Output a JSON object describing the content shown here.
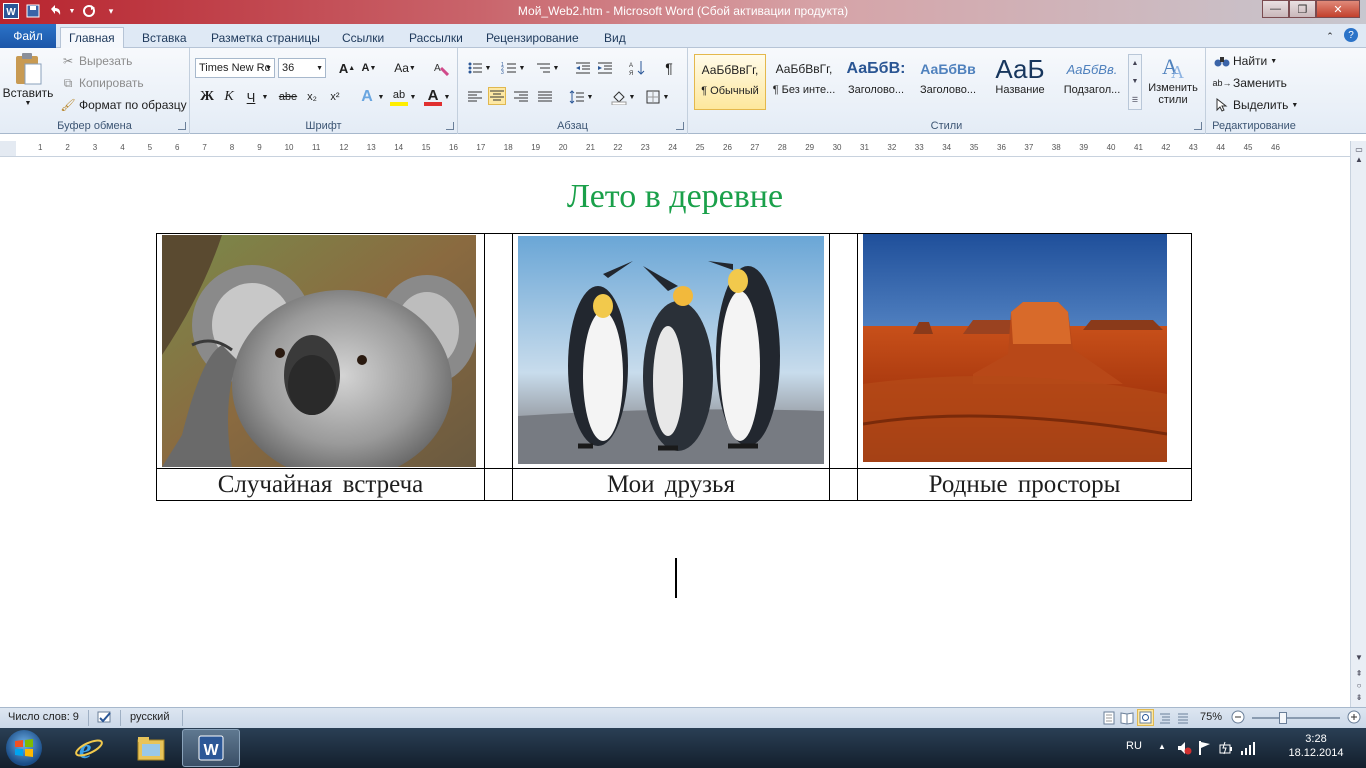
{
  "window": {
    "title": "Мой_Web2.htm - Microsoft Word (Сбой активации продукта)",
    "controls": [
      "—",
      "❐",
      "✕"
    ]
  },
  "tabs": {
    "file": "Файл",
    "items": [
      "Главная",
      "Вставка",
      "Разметка страницы",
      "Ссылки",
      "Рассылки",
      "Рецензирование",
      "Вид"
    ],
    "active": "Главная"
  },
  "clipboard": {
    "label": "Буфер обмена",
    "paste": "Вставить",
    "cut": "Вырезать",
    "copy": "Копировать",
    "format_painter": "Формат по образцу"
  },
  "font": {
    "label": "Шрифт",
    "name": "Times New Rc",
    "size": "36",
    "grow": "A",
    "shrink": "A",
    "case": "Aa",
    "bold": "Ж",
    "italic": "К",
    "underline": "Ч",
    "strike": "abe",
    "subscript": "x₂",
    "superscript": "x²",
    "text_effects": "A",
    "highlight": "ab",
    "font_color": "A",
    "font_color_hex": "#e03030"
  },
  "paragraph": {
    "label": "Абзац",
    "show_marks": "¶"
  },
  "styles": {
    "label": "Стили",
    "tiles": [
      {
        "sample": "АаБбВвГг,",
        "name": "¶ Обычный"
      },
      {
        "sample": "АаБбВвГг,",
        "name": "¶ Без инте..."
      },
      {
        "sample": "АаБбВ:",
        "name": "Заголово..."
      },
      {
        "sample": "АаБбВв",
        "name": "Заголово..."
      },
      {
        "sample": "АаБ",
        "name": "Название"
      },
      {
        "sample": "АаБбВв.",
        "name": "Подзагол..."
      }
    ],
    "change_styles": "Изменить стили"
  },
  "editing": {
    "label": "Редактирование",
    "find": "Найти",
    "replace": "Заменить",
    "select": "Выделить"
  },
  "ruler": {
    "ticks": [
      "1",
      "2",
      "3",
      "4",
      "5",
      "6",
      "7",
      "8",
      "9",
      "10",
      "11",
      "12",
      "13",
      "14",
      "15",
      "16",
      "17",
      "18",
      "19",
      "20",
      "21",
      "22",
      "23",
      "24",
      "25",
      "26",
      "27",
      "28",
      "29",
      "30",
      "31",
      "32",
      "33",
      "34",
      "35",
      "36",
      "37",
      "38",
      "39",
      "40",
      "41",
      "42",
      "43",
      "44",
      "45",
      "46"
    ]
  },
  "document": {
    "title": "Лето в деревне",
    "title_color": "#1aa04a",
    "captions": [
      "Случайная встреча",
      "Мои друзья",
      "Родные просторы"
    ],
    "images": [
      "koala-photo",
      "penguins-photo",
      "desert-photo"
    ]
  },
  "status": {
    "words": "Число слов: 9",
    "language": "русский",
    "zoom": "75%"
  },
  "taskbar": {
    "lang": "RU",
    "time": "3:28",
    "date": "18.12.2014"
  }
}
